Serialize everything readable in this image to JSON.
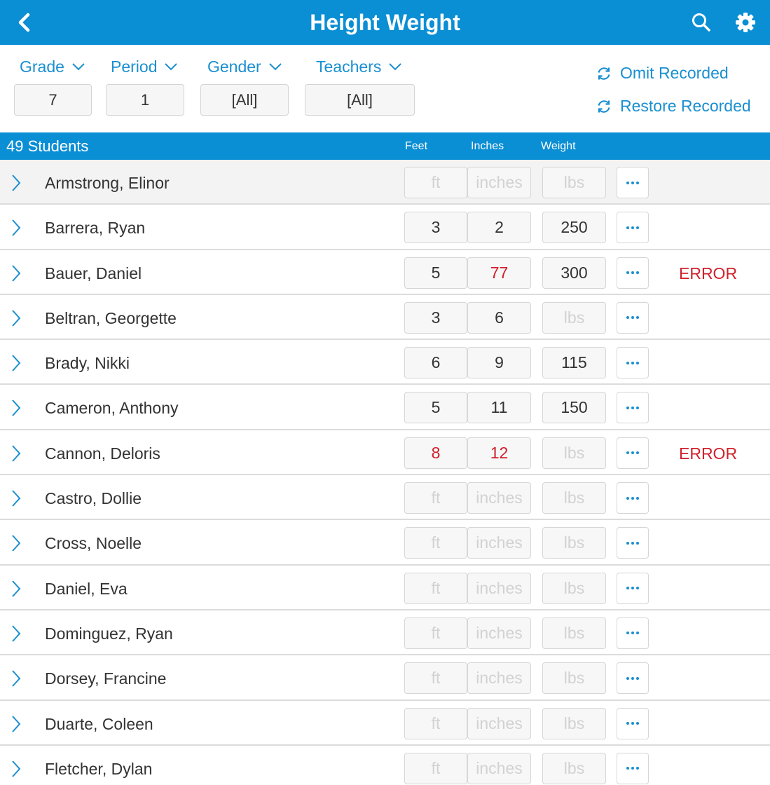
{
  "header": {
    "title": "Height Weight"
  },
  "filters": [
    {
      "label": "Grade",
      "value": "7"
    },
    {
      "label": "Period",
      "value": "1"
    },
    {
      "label": "Gender",
      "value": "[All]"
    },
    {
      "label": "Teachers",
      "value": "[All]"
    }
  ],
  "actions": {
    "omit_label": "Omit Recorded",
    "restore_label": "Restore Recorded"
  },
  "table": {
    "count_label": "49 Students",
    "columns": {
      "feet": "Feet",
      "inches": "Inches",
      "weight": "Weight"
    },
    "placeholders": {
      "feet": "ft",
      "inches": "inches",
      "weight": "lbs"
    },
    "error_label": "ERROR",
    "students": [
      {
        "name": "Armstrong, Elinor",
        "feet": "",
        "inches": "",
        "weight": "",
        "error": false,
        "feet_error": false,
        "inches_error": false
      },
      {
        "name": "Barrera, Ryan",
        "feet": "3",
        "inches": "2",
        "weight": "250",
        "error": false,
        "feet_error": false,
        "inches_error": false
      },
      {
        "name": "Bauer, Daniel",
        "feet": "5",
        "inches": "77",
        "weight": "300",
        "error": true,
        "feet_error": false,
        "inches_error": true
      },
      {
        "name": "Beltran, Georgette",
        "feet": "3",
        "inches": "6",
        "weight": "",
        "error": false,
        "feet_error": false,
        "inches_error": false
      },
      {
        "name": "Brady, Nikki",
        "feet": "6",
        "inches": "9",
        "weight": "115",
        "error": false,
        "feet_error": false,
        "inches_error": false
      },
      {
        "name": "Cameron, Anthony",
        "feet": "5",
        "inches": "11",
        "weight": "150",
        "error": false,
        "feet_error": false,
        "inches_error": false
      },
      {
        "name": "Cannon, Deloris",
        "feet": "8",
        "inches": "12",
        "weight": "",
        "error": true,
        "feet_error": true,
        "inches_error": true
      },
      {
        "name": "Castro, Dollie",
        "feet": "",
        "inches": "",
        "weight": "",
        "error": false,
        "feet_error": false,
        "inches_error": false
      },
      {
        "name": "Cross, Noelle",
        "feet": "",
        "inches": "",
        "weight": "",
        "error": false,
        "feet_error": false,
        "inches_error": false
      },
      {
        "name": "Daniel, Eva",
        "feet": "",
        "inches": "",
        "weight": "",
        "error": false,
        "feet_error": false,
        "inches_error": false
      },
      {
        "name": "Dominguez, Ryan",
        "feet": "",
        "inches": "",
        "weight": "",
        "error": false,
        "feet_error": false,
        "inches_error": false
      },
      {
        "name": "Dorsey, Francine",
        "feet": "",
        "inches": "",
        "weight": "",
        "error": false,
        "feet_error": false,
        "inches_error": false
      },
      {
        "name": "Duarte, Coleen",
        "feet": "",
        "inches": "",
        "weight": "",
        "error": false,
        "feet_error": false,
        "inches_error": false
      },
      {
        "name": "Fletcher, Dylan",
        "feet": "",
        "inches": "",
        "weight": "",
        "error": false,
        "feet_error": false,
        "inches_error": false
      }
    ]
  },
  "colors": {
    "brand": "#0a8ed4",
    "link": "#1a8fd0",
    "error": "#d0202b",
    "placeholder": "#d2d2d2"
  },
  "icons": {
    "back": "chevron-left-icon",
    "search": "search-icon",
    "settings": "gear-icon",
    "filter_toggle": "chevron-down-icon",
    "refresh": "refresh-icon",
    "row_expand": "chevron-right-icon",
    "more": "more-icon"
  }
}
